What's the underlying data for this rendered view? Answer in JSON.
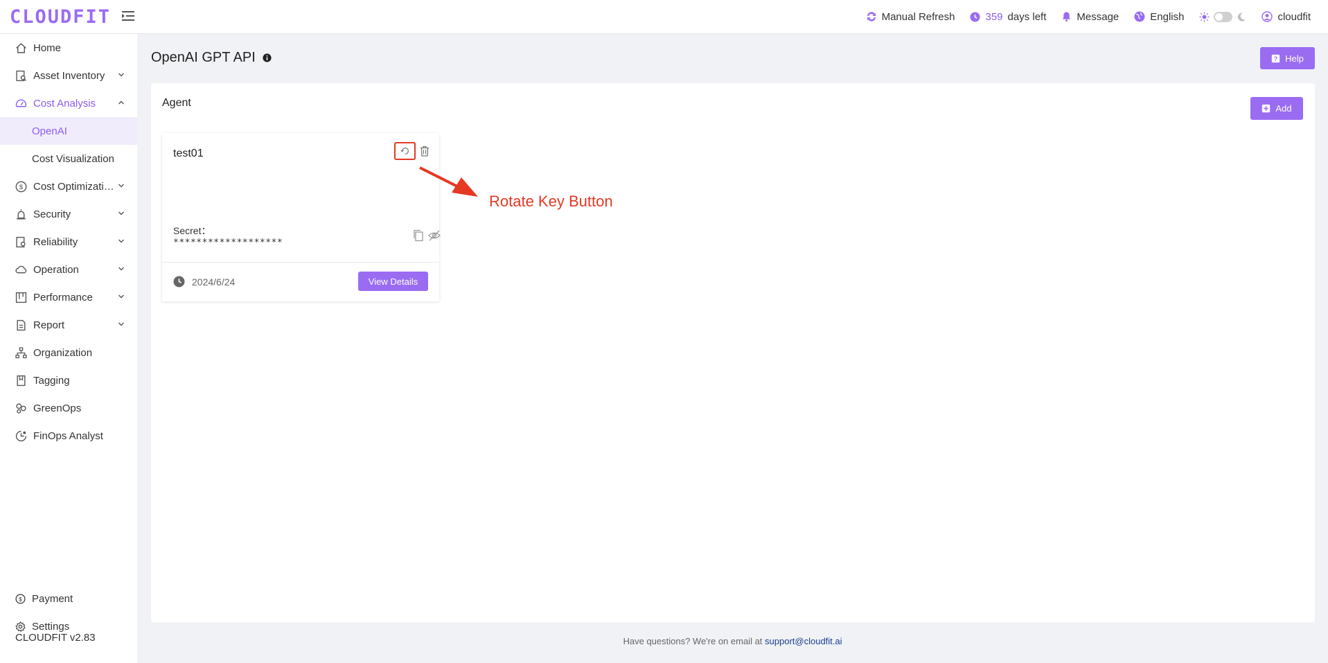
{
  "header": {
    "logo": "CLOUDFIT",
    "manual_refresh": "Manual Refresh",
    "days_left_count": "359",
    "days_left_suffix": "days left",
    "message": "Message",
    "language": "English",
    "user": "cloudfit"
  },
  "sidebar": {
    "items": [
      {
        "label": "Home"
      },
      {
        "label": "Asset Inventory"
      },
      {
        "label": "Cost Analysis"
      },
      {
        "label": "OpenAI"
      },
      {
        "label": "Cost Visualization"
      },
      {
        "label": "Cost Optimizati…"
      },
      {
        "label": "Security"
      },
      {
        "label": "Reliability"
      },
      {
        "label": "Operation"
      },
      {
        "label": "Performance"
      },
      {
        "label": "Report"
      },
      {
        "label": "Organization"
      },
      {
        "label": "Tagging"
      },
      {
        "label": "GreenOps"
      },
      {
        "label": "FinOps Analyst"
      }
    ],
    "payment": "Payment",
    "settings": "Settings",
    "version": "CLOUDFIT v2.83"
  },
  "page": {
    "title": "OpenAI GPT API",
    "help_label": "Help"
  },
  "panel": {
    "title": "Agent",
    "add_label": "Add"
  },
  "card": {
    "name": "test01",
    "secret_label": "Secret：",
    "secret_value": "*******************",
    "date": "2024/6/24",
    "view_details": "View Details"
  },
  "annotation": {
    "text": "Rotate Key Button"
  },
  "footer": {
    "text": "Have questions? We're on email at",
    "email": "support@cloudfit.ai"
  },
  "colors": {
    "accent": "#9a6cf2",
    "annotation": "#e53923"
  }
}
